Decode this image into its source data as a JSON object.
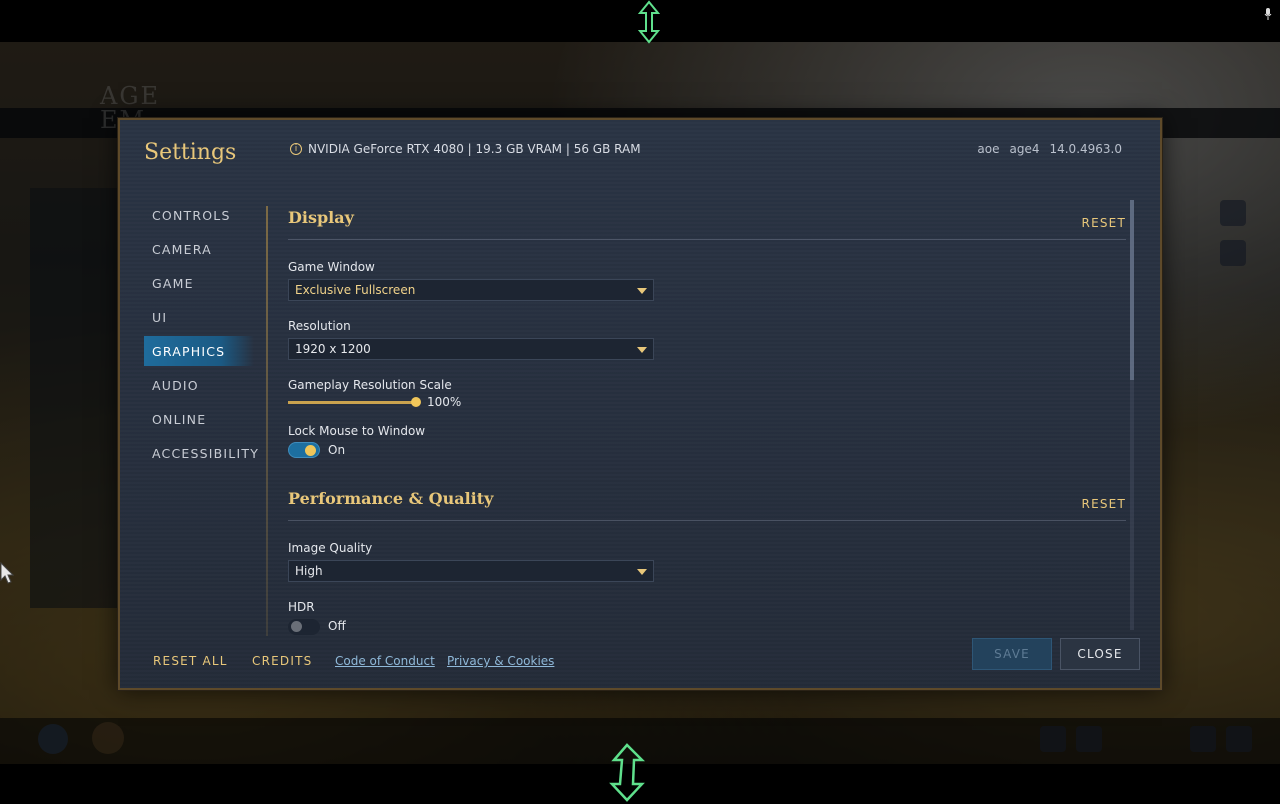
{
  "dialog": {
    "title": "Settings",
    "system_info": "NVIDIA GeForce RTX 4080 | 19.3 GB VRAM | 56 GB RAM",
    "build": {
      "part1": "aoe",
      "part2": "age4",
      "version": "14.0.4963.0"
    }
  },
  "background": {
    "logo_line1": "AGE",
    "logo_line2": "EM"
  },
  "nav": {
    "items": [
      {
        "label": "CONTROLS",
        "active": false
      },
      {
        "label": "CAMERA",
        "active": false
      },
      {
        "label": "GAME",
        "active": false
      },
      {
        "label": "UI",
        "active": false
      },
      {
        "label": "GRAPHICS",
        "active": true
      },
      {
        "label": "AUDIO",
        "active": false
      },
      {
        "label": "ONLINE",
        "active": false
      },
      {
        "label": "ACCESSIBILITY",
        "active": false
      }
    ]
  },
  "display": {
    "title": "Display",
    "reset_label": "RESET",
    "game_window": {
      "label": "Game Window",
      "value": "Exclusive Fullscreen"
    },
    "resolution": {
      "label": "Resolution",
      "value": "1920 x 1200"
    },
    "resolution_scale": {
      "label": "Gameplay Resolution Scale",
      "value": "100%",
      "fraction": 1.0
    },
    "lock_mouse": {
      "label": "Lock Mouse to Window",
      "state": "On"
    }
  },
  "performance": {
    "title": "Performance & Quality",
    "reset_label": "RESET",
    "image_quality": {
      "label": "Image Quality",
      "value": "High"
    },
    "hdr": {
      "label": "HDR",
      "state": "Off"
    }
  },
  "footer": {
    "reset_all": "RESET ALL",
    "credits": "CREDITS",
    "code_of_conduct": "Code of Conduct",
    "privacy": "Privacy & Cookies",
    "save": "SAVE",
    "close": "CLOSE"
  },
  "colors": {
    "accent_gold": "#e8c77a",
    "active_nav": "#1f6c9c",
    "panel_bg": "#27303f",
    "link": "#8fb8d8"
  }
}
